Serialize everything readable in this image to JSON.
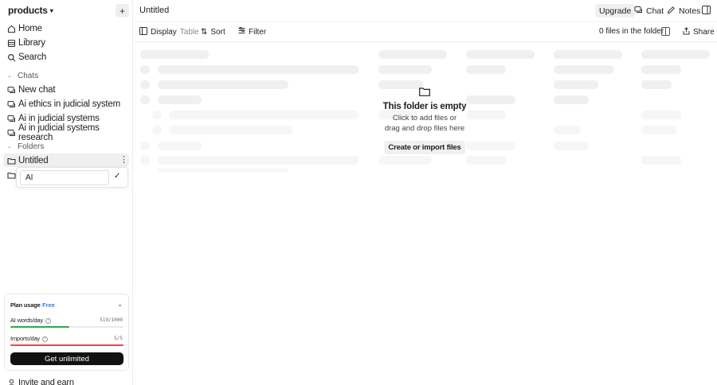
{
  "sidebar": {
    "workspace": "products",
    "nav": [
      {
        "label": "Home",
        "icon": "home-icon"
      },
      {
        "label": "Library",
        "icon": "library-icon"
      },
      {
        "label": "Search",
        "icon": "search-icon"
      }
    ],
    "chats_header": "Chats",
    "chats": [
      {
        "label": "New chat"
      },
      {
        "label": "Ai ethics in judicial system"
      },
      {
        "label": "Ai in judicial systems"
      },
      {
        "label": "Ai in judicial systems research"
      }
    ],
    "folders_header": "Folders",
    "folders": [
      {
        "label": "Untitled"
      }
    ],
    "rename_input_value": "AI",
    "plan": {
      "title": "Plan usage",
      "tier": "Free",
      "words_label": "AI words/day",
      "words_count": "519/1000",
      "words_fraction": 0.519,
      "imports_label": "Imports/day",
      "imports_count": "5/5",
      "imports_fraction": 1.0,
      "cta": "Get unlimited"
    },
    "invite": "Invite and earn"
  },
  "topbar": {
    "title": "Untitled",
    "upgrade": "Upgrade",
    "chat": "Chat",
    "notes": "Notes"
  },
  "toolbar": {
    "display": "Display",
    "display_mode": "Table",
    "sort": "Sort",
    "filter": "Filter",
    "file_count": "0 files in the folder",
    "share": "Share"
  },
  "empty_state": {
    "title": "This folder is empty",
    "line1": "Click to add files or",
    "line2": "drag and drop files here",
    "button": "Create or import files"
  },
  "colors": {
    "words_bar": "#22b04b",
    "imports_bar": "#e5484d",
    "free_badge": "#2e7bf6"
  }
}
